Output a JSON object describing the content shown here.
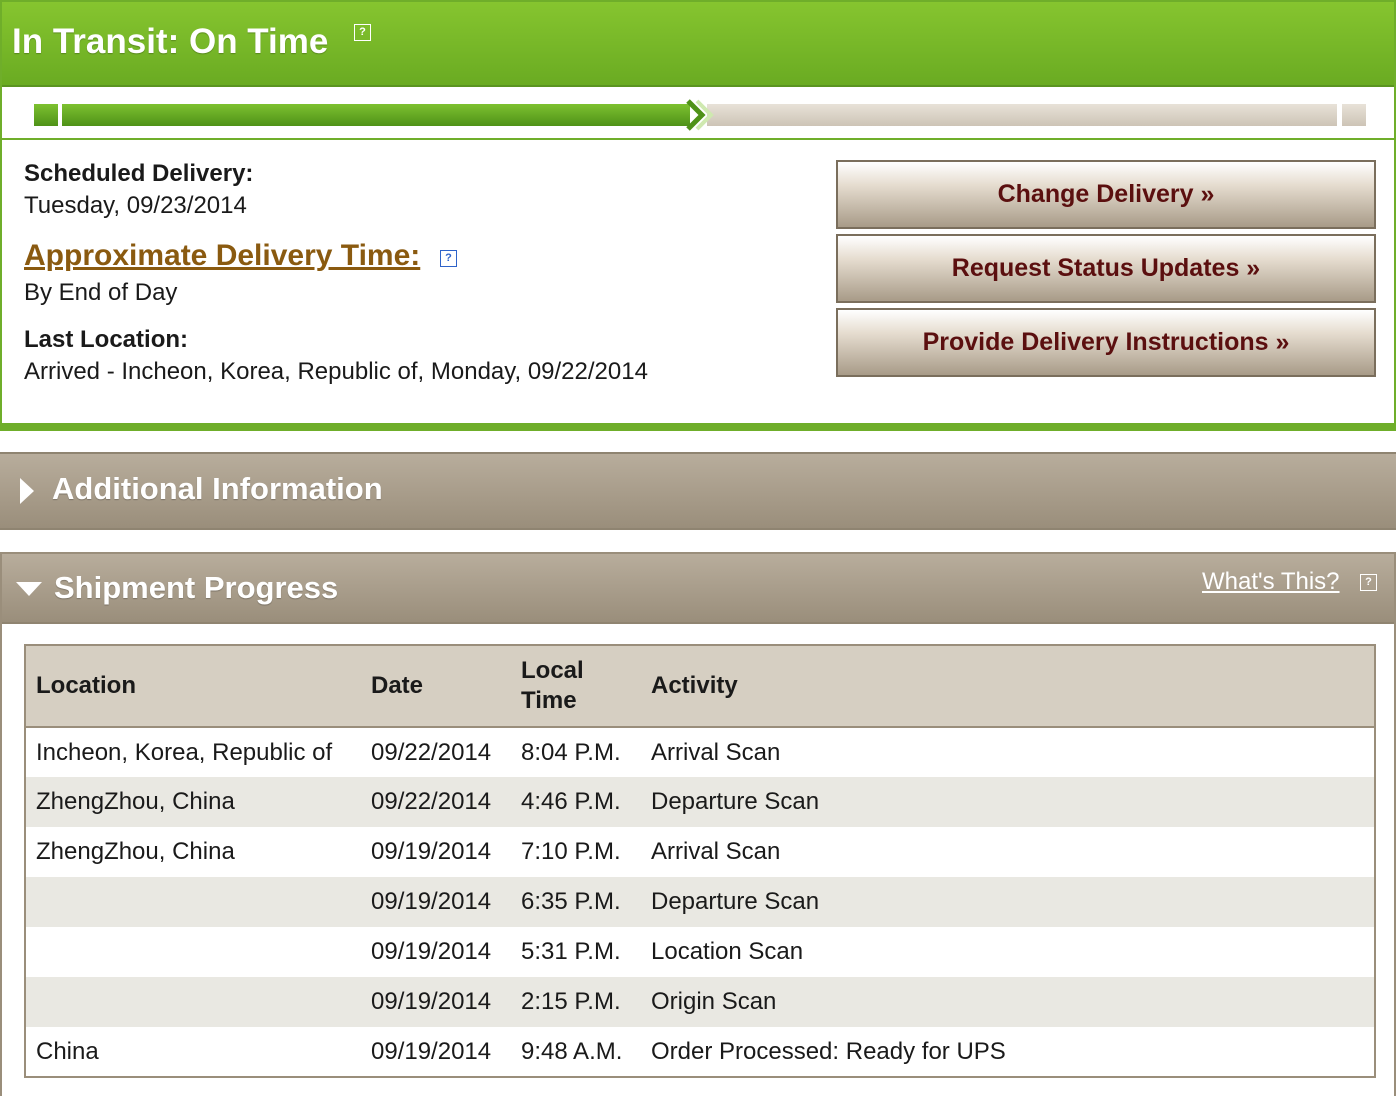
{
  "status": {
    "title": "In Transit: On Time",
    "help_icon": "?",
    "progress_fraction": 0.5
  },
  "delivery": {
    "scheduled_label": "Scheduled Delivery:",
    "scheduled_value": "Tuesday, 09/23/2014",
    "approx_label": "Approximate Delivery Time:",
    "approx_value": "By End of Day",
    "last_location_label": "Last Location:",
    "last_location_value": "Arrived - Incheon, Korea, Republic of, Monday, 09/22/2014"
  },
  "actions": {
    "change_delivery": "Change Delivery »",
    "request_updates": "Request Status Updates »",
    "delivery_instructions": "Provide Delivery Instructions »"
  },
  "additional": {
    "title": "Additional Information"
  },
  "progress": {
    "title": "Shipment Progress",
    "whats_this": "What's This?",
    "columns": {
      "location": "Location",
      "date": "Date",
      "time_line1": "Local",
      "time_line2": "Time",
      "activity": "Activity"
    },
    "rows": [
      {
        "location": "Incheon, Korea, Republic of",
        "date": "09/22/2014",
        "time": "8:04 P.M.",
        "activity": "Arrival Scan"
      },
      {
        "location": "ZhengZhou, China",
        "date": "09/22/2014",
        "time": "4:46 P.M.",
        "activity": "Departure Scan"
      },
      {
        "location": "ZhengZhou, China",
        "date": "09/19/2014",
        "time": "7:10 P.M.",
        "activity": "Arrival Scan"
      },
      {
        "location": "",
        "date": "09/19/2014",
        "time": "6:35 P.M.",
        "activity": "Departure Scan"
      },
      {
        "location": "",
        "date": "09/19/2014",
        "time": "5:31 P.M.",
        "activity": "Location Scan"
      },
      {
        "location": "",
        "date": "09/19/2014",
        "time": "2:15 P.M.",
        "activity": "Origin Scan"
      },
      {
        "location": "China",
        "date": "09/19/2014",
        "time": "9:48 A.M.",
        "activity": "Order Processed: Ready for UPS"
      }
    ]
  },
  "colors": {
    "status_green": "#6fae2a",
    "link_brown": "#8a5a10",
    "button_text": "#5b0f0f",
    "bar_taupe": "#a99d8a"
  }
}
